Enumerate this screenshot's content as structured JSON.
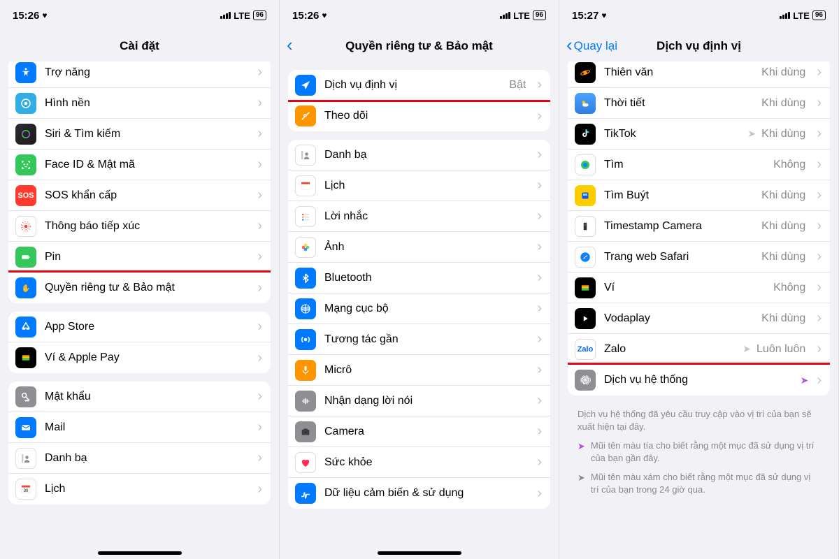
{
  "status": {
    "time1": "15:26",
    "time2": "15:26",
    "time3": "15:27",
    "net": "LTE",
    "batt": "96"
  },
  "screen1": {
    "title": "Cài đặt",
    "groupA": [
      {
        "label": "Trợ năng"
      },
      {
        "label": "Hình nền"
      },
      {
        "label": "Siri & Tìm kiếm"
      },
      {
        "label": "Face ID & Mật mã"
      },
      {
        "label": "SOS khẩn cấp"
      },
      {
        "label": "Thông báo tiếp xúc"
      },
      {
        "label": "Pin"
      },
      {
        "label": "Quyền riêng tư & Bảo mật"
      }
    ],
    "groupB": [
      {
        "label": "App Store"
      },
      {
        "label": "Ví & Apple Pay"
      }
    ],
    "groupC": [
      {
        "label": "Mật khẩu"
      },
      {
        "label": "Mail"
      },
      {
        "label": "Danh bạ"
      },
      {
        "label": "Lịch"
      }
    ]
  },
  "screen2": {
    "title": "Quyền riêng tư & Bảo mật",
    "groupA": [
      {
        "label": "Dịch vụ định vị",
        "detail": "Bật"
      },
      {
        "label": "Theo dõi"
      }
    ],
    "groupB": [
      {
        "label": "Danh bạ"
      },
      {
        "label": "Lịch"
      },
      {
        "label": "Lời nhắc"
      },
      {
        "label": "Ảnh"
      },
      {
        "label": "Bluetooth"
      },
      {
        "label": "Mạng cục bộ"
      },
      {
        "label": "Tương tác gần"
      },
      {
        "label": "Micrô"
      },
      {
        "label": "Nhận dạng lời nói"
      },
      {
        "label": "Camera"
      },
      {
        "label": "Sức khỏe"
      },
      {
        "label": "Dữ liệu cảm biến & sử dụng"
      }
    ]
  },
  "screen3": {
    "back": "Quay lại",
    "title": "Dịch vụ định vị",
    "apps": [
      {
        "label": "Thiên văn",
        "detail": "Khi dùng"
      },
      {
        "label": "Thời tiết",
        "detail": "Khi dùng"
      },
      {
        "label": "TikTok",
        "detail": "Khi dùng",
        "arrow": "gray"
      },
      {
        "label": "Tìm",
        "detail": "Không"
      },
      {
        "label": "Tìm Buýt",
        "detail": "Khi dùng"
      },
      {
        "label": "Timestamp Camera",
        "detail": "Khi dùng"
      },
      {
        "label": "Trang web Safari",
        "detail": "Khi dùng"
      },
      {
        "label": "Ví",
        "detail": "Không"
      },
      {
        "label": "Vodaplay",
        "detail": "Khi dùng"
      },
      {
        "label": "Zalo",
        "detail": "Luôn luôn",
        "arrow": "gray"
      },
      {
        "label": "Dịch vụ hệ thống",
        "detail": "",
        "arrow": "purple"
      }
    ],
    "note1": "Dịch vụ hệ thống đã yêu cầu truy cập vào vị trí của bạn sẽ xuất hiện tại đây.",
    "note2": "Mũi tên màu tía cho biết rằng một mục đã sử dụng vị trí của bạn gần đây.",
    "note3": "Mũi tên màu xám cho biết rằng một mục đã sử dụng vị trí của bạn trong 24 giờ qua."
  }
}
